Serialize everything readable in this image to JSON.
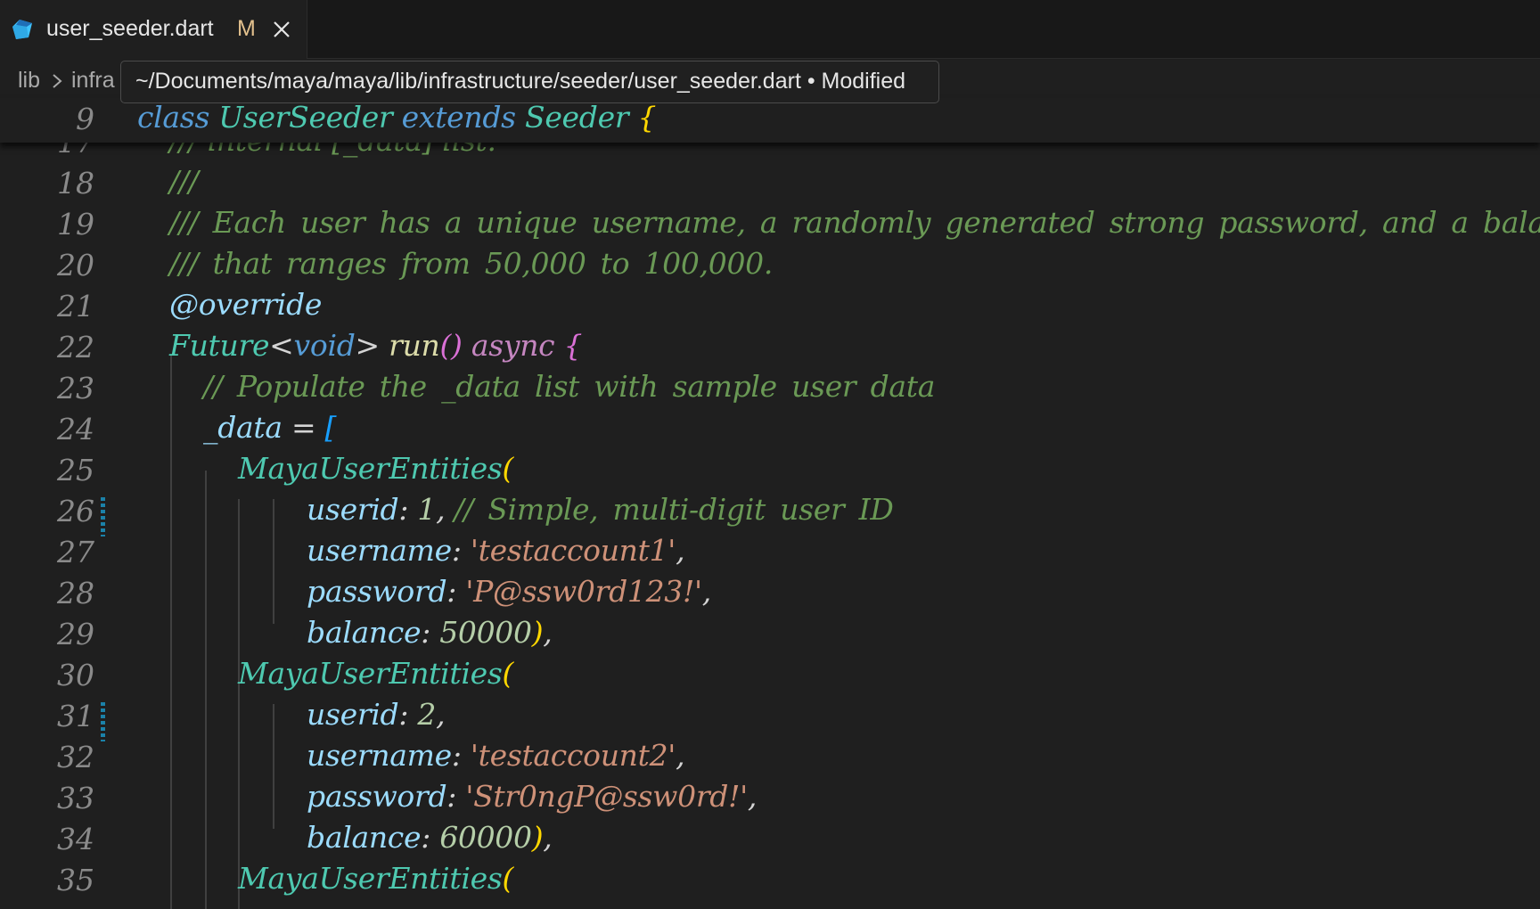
{
  "tab": {
    "filename": "user_seeder.dart",
    "status": "M"
  },
  "breadcrumb": {
    "items": [
      "lib",
      "infra"
    ]
  },
  "tooltip": {
    "text": "~/Documents/maya/maya/lib/infrastructure/seeder/user_seeder.dart • Modified"
  },
  "sticky": {
    "line_number": "9",
    "keyword_class": "class",
    "class_name": "UserSeeder",
    "keyword_extends": "extends",
    "superclass": "Seeder",
    "open_brace": "{"
  },
  "lines": [
    {
      "n": "17",
      "text": "/// internal [_data] list."
    },
    {
      "n": "18",
      "text": "///"
    },
    {
      "n": "19",
      "text": "/// Each user has a unique username, a randomly generated strong password, and a balance fie"
    },
    {
      "n": "20",
      "text": "/// that ranges from 50,000 to 100,000."
    },
    {
      "n": "21",
      "text": "@override"
    },
    {
      "n": "22",
      "type": "Future",
      "generic": "void",
      "func": "run",
      "parens": "()",
      "async": "async",
      "brace": "{"
    },
    {
      "n": "23",
      "text": "// Populate the _data list with sample user data"
    },
    {
      "n": "24",
      "var": "_data",
      "op": "=",
      "bracket": "["
    },
    {
      "n": "25",
      "class": "MayaUserEntities",
      "paren": "("
    },
    {
      "n": "26",
      "key": "userid",
      "value": "1",
      "comment": "// Simple, multi-digit user ID"
    },
    {
      "n": "27",
      "key": "username",
      "value": "'testaccount1'"
    },
    {
      "n": "28",
      "key": "password",
      "value": "'P@ssw0rd123!'"
    },
    {
      "n": "29",
      "key": "balance",
      "value": "50000",
      "close": ")"
    },
    {
      "n": "30",
      "class": "MayaUserEntities",
      "paren": "("
    },
    {
      "n": "31",
      "key": "userid",
      "value": "2"
    },
    {
      "n": "32",
      "key": "username",
      "value": "'testaccount2'"
    },
    {
      "n": "33",
      "key": "password",
      "value": "'Str0ngP@ssw0rd!'"
    },
    {
      "n": "34",
      "key": "balance",
      "value": "60000",
      "close": ")"
    },
    {
      "n": "35",
      "class": "MayaUserEntities",
      "paren": "("
    }
  ],
  "colors": {
    "comment": "#6a9955",
    "keyword": "#569cd6",
    "class": "#4ec9b0",
    "string": "#ce9178",
    "number": "#b5cea8",
    "param": "#9cdcfe",
    "modified_badge": "#e2c08d"
  },
  "icons": [
    "dart-file-icon",
    "close-icon",
    "chevron-right-icon"
  ]
}
